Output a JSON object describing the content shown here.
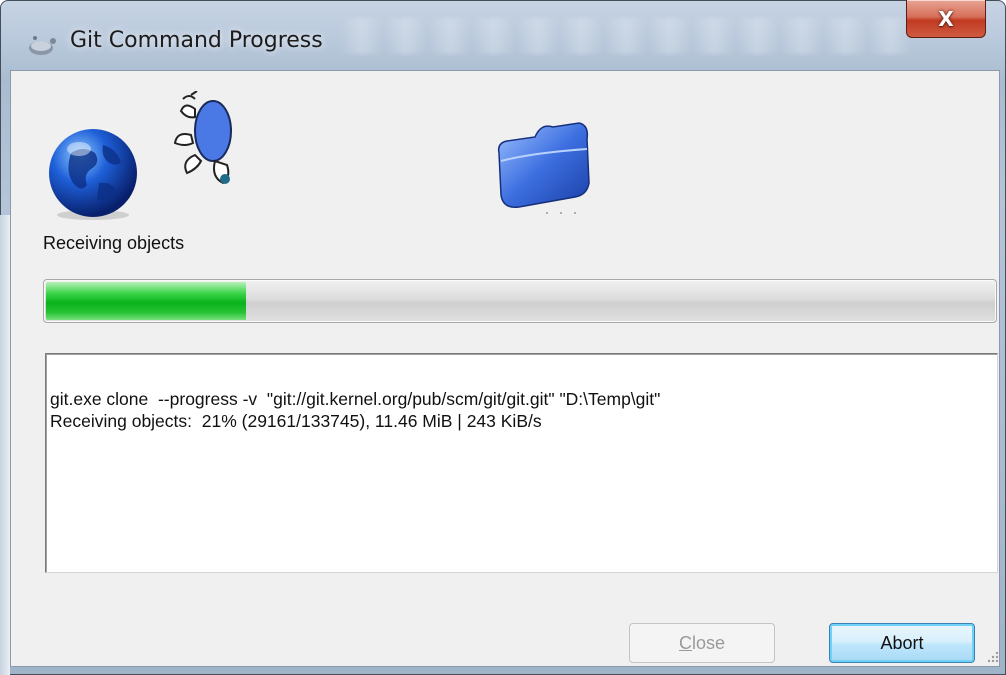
{
  "window": {
    "title": "Git Command Progress",
    "close_glyph": "X",
    "app_icon": "git-command-icon"
  },
  "animation": {
    "icons": [
      "globe-icon",
      "turtle-icon",
      "folder-icon"
    ]
  },
  "status": {
    "label": "Receiving objects"
  },
  "progress": {
    "percent": 21,
    "fill_color": "#0ab21c"
  },
  "log": {
    "lines": [
      "git.exe clone  --progress -v  \"git://git.kernel.org/pub/scm/git/git.git\" \"D:\\Temp\\git\"",
      "Receiving objects:  21% (29161/133745), 11.46 MiB | 243 KiB/s"
    ]
  },
  "buttons": {
    "close": {
      "label_first": "C",
      "label_rest": "lose",
      "enabled": false
    },
    "abort": {
      "label": "Abort",
      "enabled": true
    }
  },
  "colors": {
    "close_button": "#c13a22",
    "default_button_border": "#3c7fb1"
  }
}
